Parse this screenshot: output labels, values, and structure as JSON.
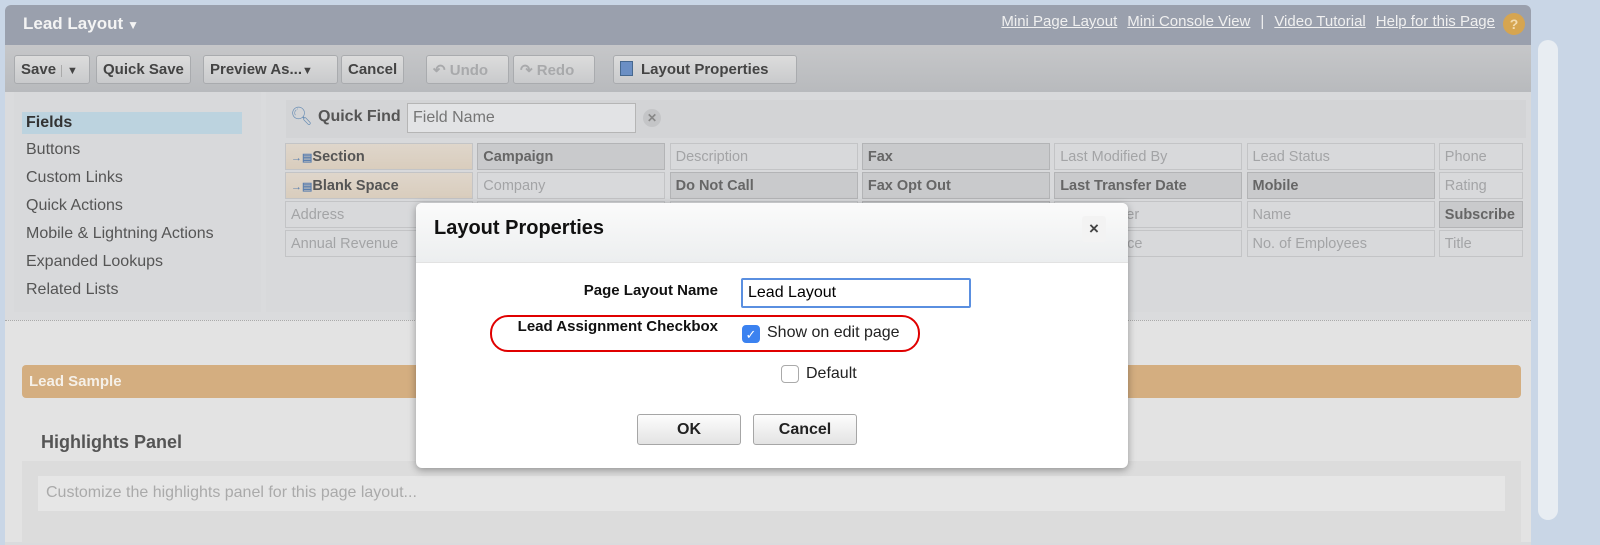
{
  "header": {
    "title": "Lead Layout",
    "links": [
      "Mini Page Layout",
      "Mini Console View",
      "Video Tutorial",
      "Help for this Page"
    ],
    "separator": "|",
    "help_icon": "?"
  },
  "toolbar": {
    "save": "Save",
    "quick_save": "Quick Save",
    "preview_as": "Preview As...",
    "cancel": "Cancel",
    "undo": "Undo",
    "redo": "Redo",
    "layout_properties": "Layout Properties"
  },
  "sidebar": {
    "items": [
      "Fields",
      "Buttons",
      "Custom Links",
      "Quick Actions",
      "Mobile & Lightning Actions",
      "Expanded Lookups",
      "Related Lists"
    ],
    "selected": "Fields"
  },
  "quick_find": {
    "label": "Quick Find",
    "placeholder": "Field Name"
  },
  "fields": [
    [
      {
        "t": "Section",
        "k": "s"
      },
      {
        "t": "Campaign",
        "k": "b"
      },
      {
        "t": "Description",
        "k": ""
      },
      {
        "t": "Fax",
        "k": "b"
      },
      {
        "t": "Last Modified By",
        "k": ""
      },
      {
        "t": "Lead Status",
        "k": ""
      },
      {
        "t": "Phone",
        "k": ""
      }
    ],
    [
      {
        "t": "Blank Space",
        "k": "s"
      },
      {
        "t": "Company",
        "k": ""
      },
      {
        "t": "Do Not Call",
        "k": "b"
      },
      {
        "t": "Fax Opt Out",
        "k": "b"
      },
      {
        "t": "Last Transfer Date",
        "k": "b"
      },
      {
        "t": "Mobile",
        "k": "b"
      },
      {
        "t": "Rating",
        "k": ""
      }
    ],
    [
      {
        "t": "Address",
        "k": ""
      },
      {
        "t": "",
        "k": ""
      },
      {
        "t": "",
        "k": ""
      },
      {
        "t": "",
        "k": "b"
      },
      {
        "t": "Lead Owner",
        "k": ""
      },
      {
        "t": "Name",
        "k": ""
      },
      {
        "t": "Subscribe",
        "k": "b"
      }
    ],
    [
      {
        "t": "Annual Revenue",
        "k": ""
      },
      {
        "t": "",
        "k": ""
      },
      {
        "t": "",
        "k": ""
      },
      {
        "t": "",
        "k": ""
      },
      {
        "t": "Lead Source",
        "k": ""
      },
      {
        "t": "No. of Employees",
        "k": ""
      },
      {
        "t": "Title",
        "k": ""
      }
    ]
  ],
  "layout": {
    "section_title": "Lead Sample",
    "highlights_title": "Highlights Panel",
    "highlights_placeholder": "Customize the highlights panel for this page layout..."
  },
  "modal": {
    "title": "Layout Properties",
    "close": "×",
    "page_layout_name_label": "Page Layout Name",
    "page_layout_name_value": "Lead Layout",
    "lead_assignment_label": "Lead Assignment Checkbox",
    "show_on_edit_label": "Show on edit page",
    "show_on_edit_checked": true,
    "default_label": "Default",
    "default_checked": false,
    "ok": "OK",
    "cancel": "Cancel",
    "highlight_color": "#e00000"
  }
}
